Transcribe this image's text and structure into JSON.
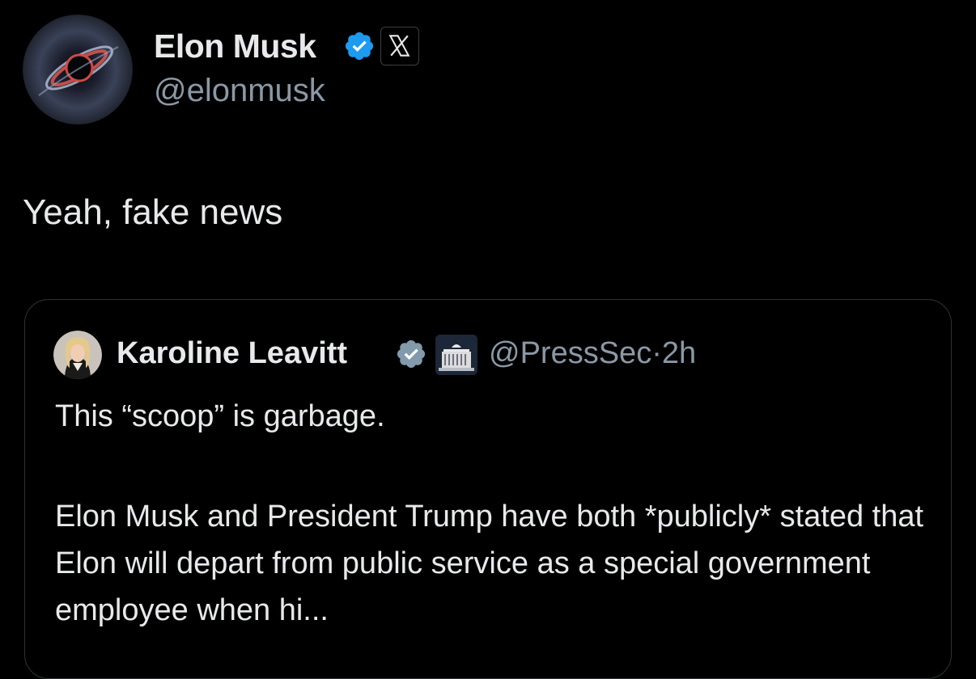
{
  "post": {
    "author_name": "Elon Musk",
    "author_handle": "@elonmusk",
    "text": "Yeah, fake news"
  },
  "quoted_post": {
    "author_name": "Karoline Leavitt",
    "handle": "@PressSec",
    "separator": "·",
    "time": "2h",
    "first_line": "This “scoop” is garbage.",
    "body": "Elon Musk and President Trump have both *publicly* stated that Elon will depart from public service as a special government employee when hi..."
  },
  "icons": {
    "verified": "verified-badge-icon",
    "x_affiliation": "x-logo-icon",
    "white_house": "white-house-icon"
  },
  "colors": {
    "verified_blue": "#1d9bf0",
    "quote_verified_gray": "#829aab",
    "background": "#000000",
    "text": "#e7e9ea",
    "secondary_text": "#8b98a5"
  }
}
